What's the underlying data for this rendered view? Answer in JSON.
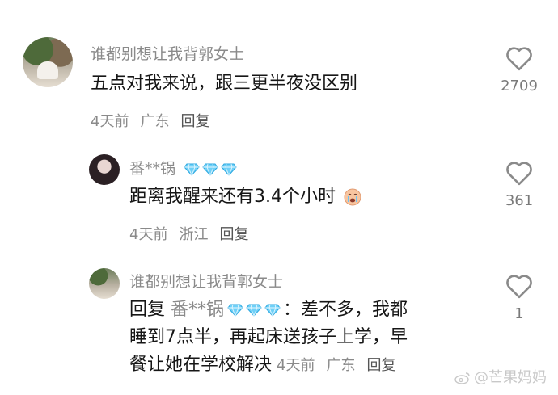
{
  "comments": [
    {
      "username": "谁都别想让我背郭女士",
      "text": "五点对我来说，跟三更半夜没区别",
      "time": "4天前",
      "location": "广东",
      "reply_label": "回复",
      "likes": "2709"
    },
    {
      "username": "番**锅",
      "badge_count": 3,
      "text": "距离我醒来还有3.4个小时",
      "emoji": "crying-face-icon",
      "time": "4天前",
      "location": "浙江",
      "reply_label": "回复",
      "likes": "361"
    },
    {
      "username": "谁都别想让我背郭女士",
      "reply_prefix": "回复",
      "reply_to": "番**锅",
      "line1_tail": "：差不多，我都",
      "line2": "睡到7点半，再起床送孩子上学，早",
      "line3": "餐让她在学校解决",
      "time": "4天前",
      "location": "广东",
      "reply_label": "回复",
      "likes": "1"
    }
  ],
  "watermark": "@芒果妈妈",
  "colors": {
    "meta_gray": "#8a8a8a",
    "diamond_blue": "#5bc8f5"
  }
}
